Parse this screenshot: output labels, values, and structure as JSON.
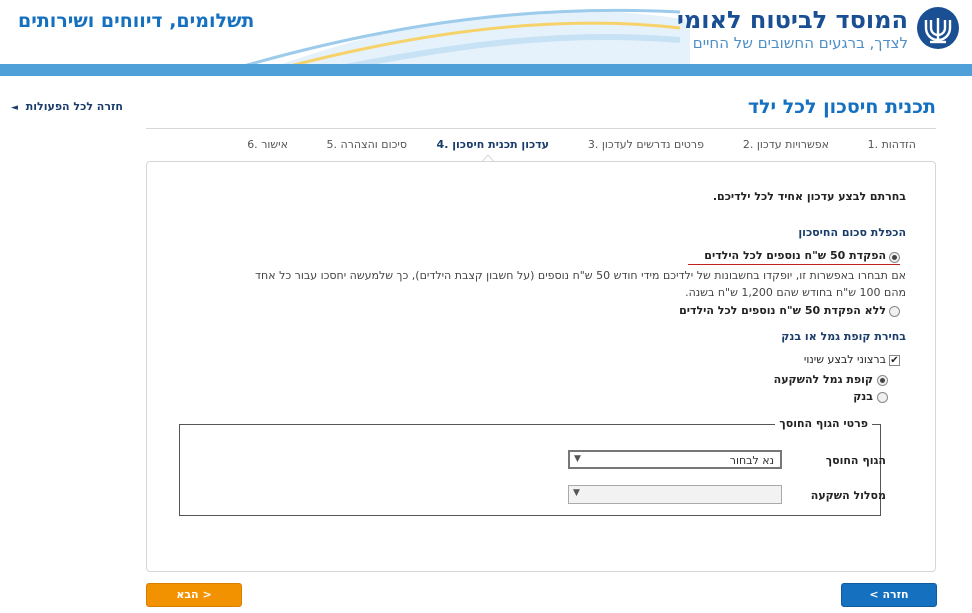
{
  "header": {
    "section_title": "תשלומים, דיווחים ושירותים",
    "logo_title": "המוסד לביטוח לאומי",
    "logo_subtitle": "לצדך, ברגעים החשובים של החיים",
    "logo_icon": "menorah-logo-icon"
  },
  "nav": {
    "back_all": "חזרה לכל הפעולות"
  },
  "page": {
    "title": "תכנית חיסכון לכל ילד"
  },
  "steps": [
    {
      "label": "1. הזדהות",
      "active": false
    },
    {
      "label": "2. אפשרויות עדכון",
      "active": false
    },
    {
      "label": "3. פרטים נדרשים לעדכון",
      "active": false
    },
    {
      "label": "4. עדכון תכנית חיסכון",
      "active": true
    },
    {
      "label": "5. סיכום והצהרה",
      "active": false
    },
    {
      "label": "6. אישור",
      "active": false
    }
  ],
  "form": {
    "intro": "בחרתם לבצע עדכון אחיד לכל ילדיכם.",
    "doubling": {
      "heading": "הכפלת סכום החיסכון",
      "option1": "הפקדת 50 ש\"ח נוספים לכל הילדים",
      "option1_note_line1": "אם תבחרו באפשרות זו, יופקדו בחשבונות של ילדיכם מידי חודש 50 ש\"ח נוספים (על חשבון קצבת הילדים), כך שלמעשה יחסכו עבור כל אחד",
      "option1_note_line2": "מהם 100 ש\"ח בחודש שהם 1,200 ש\"ח בשנה.",
      "option2": "ללא הפקדת 50 ש\"ח נוספים לכל הילדים",
      "selected": "option1"
    },
    "fund_choice": {
      "heading": "בחירת קופת גמל או בנק",
      "change_checkbox": "ברצוני לבצע שינוי",
      "change_checked": true,
      "option_fund": "קופת גמל להשקעה",
      "option_bank": "בנק",
      "selected": "fund"
    },
    "managing_body": {
      "legend": "פרטי הגוף החוסך",
      "body_label": "הגוף החוסך",
      "body_value": "נא לבחור",
      "track_label": "מסלול השקעה",
      "track_value": ""
    }
  },
  "buttons": {
    "next": "הבא >",
    "back": "< חזרה"
  },
  "colors": {
    "brand_blue": "#1570c0",
    "accent_orange": "#f39200",
    "header_bar": "#4fa0d8"
  }
}
